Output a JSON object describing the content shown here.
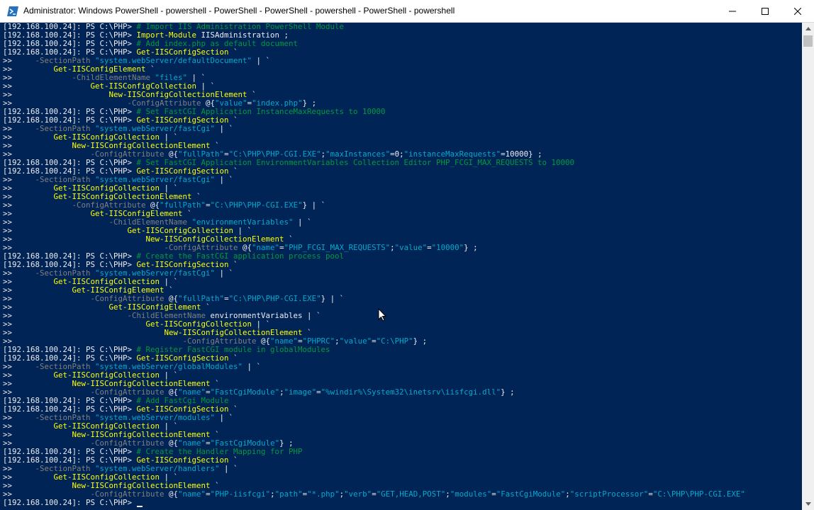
{
  "window": {
    "title": "Administrator: Windows PowerShell - powershell - PowerShell - PowerShell - powershell - PowerShell - powershell",
    "icon": "powershell-icon",
    "controls": [
      "minimize-icon",
      "maximize-icon",
      "close-icon"
    ]
  },
  "colors": {
    "background": "#012456",
    "prompt": "#eeedf0",
    "cmdlet": "#ffff00",
    "string": "#00abcd",
    "comment": "#009a3c",
    "parameter": "#808080"
  },
  "console": {
    "lines": [
      [
        [
          "p",
          "[192.168.100.24]: PS C:\\PHP> "
        ],
        [
          "c",
          "# Import IIS Administration PowerShell Module"
        ]
      ],
      [
        [
          "p",
          "[192.168.100.24]: PS C:\\PHP> "
        ],
        [
          "k",
          "Import-Module"
        ],
        [
          "o",
          " IISAdministration ;"
        ]
      ],
      [
        [
          "p",
          "[192.168.100.24]: PS C:\\PHP> "
        ],
        [
          "c",
          "# Add index.php as default document"
        ]
      ],
      [
        [
          "p",
          "[192.168.100.24]: PS C:\\PHP> "
        ],
        [
          "k",
          "Get-IISConfigSection"
        ],
        [
          "o",
          " `"
        ]
      ],
      [
        [
          "p",
          ">>     "
        ],
        [
          "a",
          "-SectionPath "
        ],
        [
          "s",
          "\"system.webServer/defaultDocument\""
        ],
        [
          "o",
          " | `"
        ]
      ],
      [
        [
          "p",
          ">>         "
        ],
        [
          "k",
          "Get-IISConfigElement"
        ],
        [
          "o",
          " `"
        ]
      ],
      [
        [
          "p",
          ">>             "
        ],
        [
          "a",
          "-ChildElementName "
        ],
        [
          "s",
          "\"files\""
        ],
        [
          "o",
          " | `"
        ]
      ],
      [
        [
          "p",
          ">>                 "
        ],
        [
          "k",
          "Get-IISConfigCollection"
        ],
        [
          "o",
          " | `"
        ]
      ],
      [
        [
          "p",
          ">>                     "
        ],
        [
          "k",
          "New-IISConfigCollectionElement"
        ],
        [
          "o",
          " `"
        ]
      ],
      [
        [
          "p",
          ">>                         "
        ],
        [
          "a",
          "-ConfigAttribute "
        ],
        [
          "o",
          "@{"
        ],
        [
          "s",
          "\"value\""
        ],
        [
          "o",
          "="
        ],
        [
          "s",
          "\"index.php\""
        ],
        [
          "o",
          "} ;"
        ]
      ],
      [
        [
          "p",
          "[192.168.100.24]: PS C:\\PHP> "
        ],
        [
          "c",
          "# Set FastCGI Application InstanceMaxRequests to 10000"
        ]
      ],
      [
        [
          "p",
          "[192.168.100.24]: PS C:\\PHP> "
        ],
        [
          "k",
          "Get-IISConfigSection"
        ],
        [
          "o",
          " `"
        ]
      ],
      [
        [
          "p",
          ">>     "
        ],
        [
          "a",
          "-SectionPath "
        ],
        [
          "s",
          "\"system.webServer/fastCgi\""
        ],
        [
          "o",
          " | `"
        ]
      ],
      [
        [
          "p",
          ">>         "
        ],
        [
          "k",
          "Get-IISConfigCollection"
        ],
        [
          "o",
          " | `"
        ]
      ],
      [
        [
          "p",
          ">>             "
        ],
        [
          "k",
          "New-IISConfigCollectionElement"
        ],
        [
          "o",
          " `"
        ]
      ],
      [
        [
          "p",
          ">>                 "
        ],
        [
          "a",
          "-ConfigAttribute "
        ],
        [
          "o",
          "@{"
        ],
        [
          "s",
          "\"fullPath\""
        ],
        [
          "o",
          "="
        ],
        [
          "s",
          "\"C:\\PHP\\PHP-CGI.EXE\""
        ],
        [
          "o",
          ";"
        ],
        [
          "s",
          "\"maxInstances\""
        ],
        [
          "o",
          "=0;"
        ],
        [
          "s",
          "\"instanceMaxRequests\""
        ],
        [
          "o",
          "=10000} ;"
        ]
      ],
      [
        [
          "p",
          "[192.168.100.24]: PS C:\\PHP> "
        ],
        [
          "c",
          "# Set FastCGI Application EnvironmentVariables Collection Editor PHP_FCGI_MAX_REQUESTS to 10000"
        ]
      ],
      [
        [
          "p",
          "[192.168.100.24]: PS C:\\PHP> "
        ],
        [
          "k",
          "Get-IISConfigSection"
        ],
        [
          "o",
          " `"
        ]
      ],
      [
        [
          "p",
          ">>     "
        ],
        [
          "a",
          "-SectionPath "
        ],
        [
          "s",
          "\"system.webServer/fastCgi\""
        ],
        [
          "o",
          " | `"
        ]
      ],
      [
        [
          "p",
          ">>         "
        ],
        [
          "k",
          "Get-IISConfigCollection"
        ],
        [
          "o",
          " | `"
        ]
      ],
      [
        [
          "p",
          ">>         "
        ],
        [
          "k",
          "Get-IISConfigCollectionElement"
        ],
        [
          "o",
          " `"
        ]
      ],
      [
        [
          "p",
          ">>             "
        ],
        [
          "a",
          "-ConfigAttribute "
        ],
        [
          "o",
          "@{"
        ],
        [
          "s",
          "\"fullPath\""
        ],
        [
          "o",
          "="
        ],
        [
          "s",
          "\"C:\\PHP\\PHP-CGI.EXE\""
        ],
        [
          "o",
          "} | `"
        ]
      ],
      [
        [
          "p",
          ">>                 "
        ],
        [
          "k",
          "Get-IISConfigElement"
        ],
        [
          "o",
          " `"
        ]
      ],
      [
        [
          "p",
          ">>                     "
        ],
        [
          "a",
          "-ChildElementName "
        ],
        [
          "s",
          "\"environmentVariables\""
        ],
        [
          "o",
          " | `"
        ]
      ],
      [
        [
          "p",
          ">>                         "
        ],
        [
          "k",
          "Get-IISConfigCollection"
        ],
        [
          "o",
          " | `"
        ]
      ],
      [
        [
          "p",
          ">>                             "
        ],
        [
          "k",
          "New-IISConfigCollectionElement"
        ],
        [
          "o",
          " `"
        ]
      ],
      [
        [
          "p",
          ">>                                 "
        ],
        [
          "a",
          "-ConfigAttribute "
        ],
        [
          "o",
          "@{"
        ],
        [
          "s",
          "\"name\""
        ],
        [
          "o",
          "="
        ],
        [
          "s",
          "\"PHP_FCGI_MAX_REQUESTS\""
        ],
        [
          "o",
          ";"
        ],
        [
          "s",
          "\"value\""
        ],
        [
          "o",
          "="
        ],
        [
          "s",
          "\"10000\""
        ],
        [
          "o",
          "} ;"
        ]
      ],
      [
        [
          "p",
          "[192.168.100.24]: PS C:\\PHP> "
        ],
        [
          "c",
          "# Create the FastCGI application process pool"
        ]
      ],
      [
        [
          "p",
          "[192.168.100.24]: PS C:\\PHP> "
        ],
        [
          "k",
          "Get-IISConfigSection"
        ],
        [
          "o",
          " `"
        ]
      ],
      [
        [
          "p",
          ">>     "
        ],
        [
          "a",
          "-SectionPath "
        ],
        [
          "s",
          "\"system.webServer/fastCgi\""
        ],
        [
          "o",
          " | `"
        ]
      ],
      [
        [
          "p",
          ">>         "
        ],
        [
          "k",
          "Get-IISConfigCollection"
        ],
        [
          "o",
          " | `"
        ]
      ],
      [
        [
          "p",
          ">>             "
        ],
        [
          "k",
          "Get-IISConfigElement"
        ],
        [
          "o",
          " `"
        ]
      ],
      [
        [
          "p",
          ">>                 "
        ],
        [
          "a",
          "-ConfigAttribute "
        ],
        [
          "o",
          "@{"
        ],
        [
          "s",
          "\"fullPath\""
        ],
        [
          "o",
          "="
        ],
        [
          "s",
          "\"C:\\PHP\\PHP-CGI.EXE\""
        ],
        [
          "o",
          "} | `"
        ]
      ],
      [
        [
          "p",
          ">>                     "
        ],
        [
          "k",
          "Get-IISConfigElement"
        ],
        [
          "o",
          " `"
        ]
      ],
      [
        [
          "p",
          ">>                         "
        ],
        [
          "a",
          "-ChildElementName "
        ],
        [
          "o",
          "environmentVariables | `"
        ]
      ],
      [
        [
          "p",
          ">>                             "
        ],
        [
          "k",
          "Get-IISConfigCollection"
        ],
        [
          "o",
          " | `"
        ]
      ],
      [
        [
          "p",
          ">>                                 "
        ],
        [
          "k",
          "New-IISConfigCollectionElement"
        ],
        [
          "o",
          " `"
        ]
      ],
      [
        [
          "p",
          ">>                                     "
        ],
        [
          "a",
          "-ConfigAttribute "
        ],
        [
          "o",
          "@{"
        ],
        [
          "s",
          "\"name\""
        ],
        [
          "o",
          "="
        ],
        [
          "s",
          "\"PHPRC\""
        ],
        [
          "o",
          ";"
        ],
        [
          "s",
          "\"value\""
        ],
        [
          "o",
          "="
        ],
        [
          "s",
          "\"C:\\PHP\""
        ],
        [
          "o",
          "} ;"
        ]
      ],
      [
        [
          "p",
          "[192.168.100.24]: PS C:\\PHP> "
        ],
        [
          "c",
          "# Register FastCGI module in globalModules"
        ]
      ],
      [
        [
          "p",
          "[192.168.100.24]: PS C:\\PHP> "
        ],
        [
          "k",
          "Get-IISConfigSection"
        ],
        [
          "o",
          " `"
        ]
      ],
      [
        [
          "p",
          ">>     "
        ],
        [
          "a",
          "-SectionPath "
        ],
        [
          "s",
          "\"system.webServer/globalModules\""
        ],
        [
          "o",
          " | `"
        ]
      ],
      [
        [
          "p",
          ">>         "
        ],
        [
          "k",
          "Get-IISConfigCollection"
        ],
        [
          "o",
          " | `"
        ]
      ],
      [
        [
          "p",
          ">>             "
        ],
        [
          "k",
          "New-IISConfigCollectionElement"
        ],
        [
          "o",
          " `"
        ]
      ],
      [
        [
          "p",
          ">>                 "
        ],
        [
          "a",
          "-ConfigAttribute "
        ],
        [
          "o",
          "@{"
        ],
        [
          "s",
          "\"name\""
        ],
        [
          "o",
          "="
        ],
        [
          "s",
          "\"FastCgiModule\""
        ],
        [
          "o",
          ";"
        ],
        [
          "s",
          "\"image\""
        ],
        [
          "o",
          "="
        ],
        [
          "s",
          "\"%windir%\\System32\\inetsrv\\iisfcgi.dll\""
        ],
        [
          "o",
          "} ;"
        ]
      ],
      [
        [
          "p",
          "[192.168.100.24]: PS C:\\PHP> "
        ],
        [
          "c",
          "# Add FastCgi Module"
        ]
      ],
      [
        [
          "p",
          "[192.168.100.24]: PS C:\\PHP> "
        ],
        [
          "k",
          "Get-IISConfigSection"
        ],
        [
          "o",
          " `"
        ]
      ],
      [
        [
          "p",
          ">>     "
        ],
        [
          "a",
          "-SectionPath "
        ],
        [
          "s",
          "\"system.webServer/modules\""
        ],
        [
          "o",
          " | `"
        ]
      ],
      [
        [
          "p",
          ">>         "
        ],
        [
          "k",
          "Get-IISConfigCollection"
        ],
        [
          "o",
          " | `"
        ]
      ],
      [
        [
          "p",
          ">>             "
        ],
        [
          "k",
          "New-IISConfigCollectionElement"
        ],
        [
          "o",
          " `"
        ]
      ],
      [
        [
          "p",
          ">>                 "
        ],
        [
          "a",
          "-ConfigAttribute "
        ],
        [
          "o",
          "@{"
        ],
        [
          "s",
          "\"name\""
        ],
        [
          "o",
          "="
        ],
        [
          "s",
          "\"FastCgiModule\""
        ],
        [
          "o",
          "} ;"
        ]
      ],
      [
        [
          "p",
          "[192.168.100.24]: PS C:\\PHP> "
        ],
        [
          "c",
          "# Create the Handler Mapping for PHP"
        ]
      ],
      [
        [
          "p",
          "[192.168.100.24]: PS C:\\PHP> "
        ],
        [
          "k",
          "Get-IISConfigSection"
        ],
        [
          "o",
          " `"
        ]
      ],
      [
        [
          "p",
          ">>     "
        ],
        [
          "a",
          "-SectionPath "
        ],
        [
          "s",
          "\"system.webServer/handlers\""
        ],
        [
          "o",
          " | `"
        ]
      ],
      [
        [
          "p",
          ">>         "
        ],
        [
          "k",
          "Get-IISConfigCollection"
        ],
        [
          "o",
          " | `"
        ]
      ],
      [
        [
          "p",
          ">>             "
        ],
        [
          "k",
          "New-IISConfigCollectionElement"
        ],
        [
          "o",
          " `"
        ]
      ],
      [
        [
          "p",
          ">>                 "
        ],
        [
          "a",
          "-ConfigAttribute "
        ],
        [
          "o",
          "@{"
        ],
        [
          "s",
          "\"name\""
        ],
        [
          "o",
          "="
        ],
        [
          "s",
          "\"PHP-iisfcgi\""
        ],
        [
          "o",
          ";"
        ],
        [
          "s",
          "\"path\""
        ],
        [
          "o",
          "="
        ],
        [
          "s",
          "\"*.php\""
        ],
        [
          "o",
          ";"
        ],
        [
          "s",
          "\"verb\""
        ],
        [
          "o",
          "="
        ],
        [
          "s",
          "\"GET,HEAD,POST\""
        ],
        [
          "o",
          ";"
        ],
        [
          "s",
          "\"modules\""
        ],
        [
          "o",
          "="
        ],
        [
          "s",
          "\"FastCgiModule\""
        ],
        [
          "o",
          ";"
        ],
        [
          "s",
          "\"scriptProcessor\""
        ],
        [
          "o",
          "="
        ],
        [
          "s",
          "\"C:\\PHP\\PHP-CGI.EXE\""
        ]
      ],
      [
        [
          "p",
          "[192.168.100.24]: PS C:\\PHP> "
        ]
      ]
    ]
  }
}
